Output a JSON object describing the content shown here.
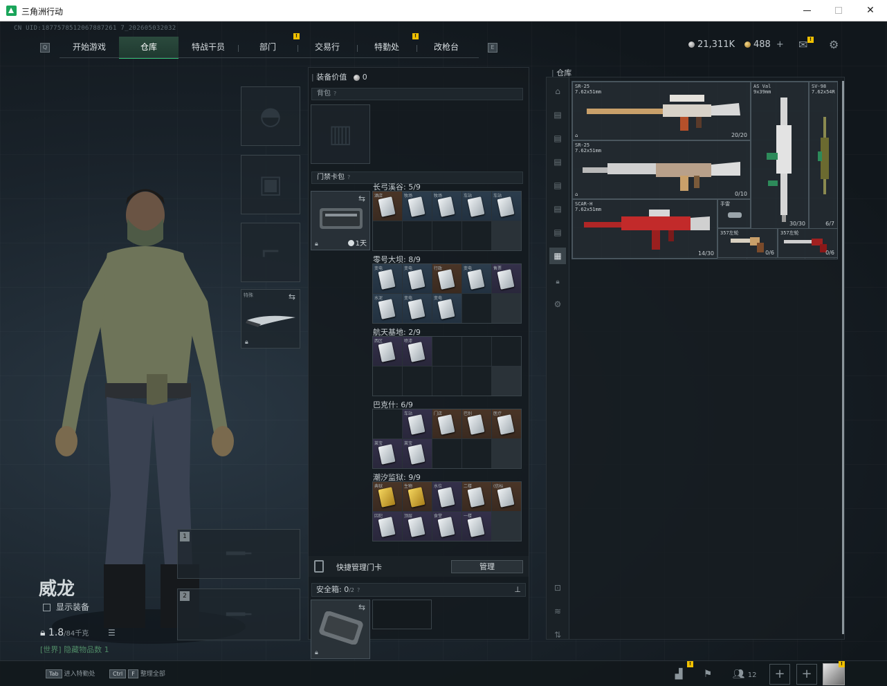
{
  "window": {
    "title": "三角洲行动"
  },
  "uid": "CN UID:1877578512067887261 7_202605032032",
  "nav": {
    "left_key": "Q",
    "right_key": "E",
    "tabs": [
      {
        "label": "开始游戏",
        "active": false,
        "alert": false
      },
      {
        "label": "仓库",
        "active": true,
        "alert": false
      },
      {
        "label": "特战干员",
        "active": false,
        "alert": false
      },
      {
        "label": "部门",
        "active": false,
        "alert": true
      },
      {
        "label": "交易行",
        "active": false,
        "alert": false
      },
      {
        "label": "特勤处",
        "active": false,
        "alert": true
      },
      {
        "label": "改枪台",
        "active": false,
        "alert": false
      }
    ]
  },
  "currency": {
    "silver": "21,311K",
    "gold": "488",
    "add": "+"
  },
  "alert_mark": "!",
  "operator": {
    "name": "威龙",
    "show_gear_label": "显示装备",
    "weight": "1.8",
    "weight_max": "/84千克",
    "world_tag": "[世界] 隐藏物品数 1"
  },
  "equip_slots": {
    "melee_label": "特殊",
    "primary_num": "1",
    "secondary_num": "2"
  },
  "loadout": {
    "value_label": "装备价值",
    "value": "0",
    "backpack_label": "背包",
    "keycard_bag_label": "门禁卡包",
    "keycard_time": "1天",
    "maps": [
      {
        "title": "长弓溪谷: 5/9",
        "cards": [
          {
            "name": "酒店",
            "tier": "brown"
          },
          {
            "name": "牧场",
            "tier": "blue"
          },
          {
            "name": "牧场",
            "tier": "blue"
          },
          {
            "name": "车站",
            "tier": "blue"
          },
          {
            "name": "车站",
            "tier": "blue"
          }
        ]
      },
      {
        "title": "零号大坝: 8/9",
        "cards": [
          {
            "name": "变电",
            "tier": "blue"
          },
          {
            "name": "变电",
            "tier": "blue"
          },
          {
            "name": "行政",
            "tier": "brown"
          },
          {
            "name": "变电",
            "tier": "blue"
          },
          {
            "name": "售票",
            "tier": "purple"
          },
          {
            "name": "水泥",
            "tier": "blue"
          },
          {
            "name": "变电",
            "tier": "blue"
          },
          {
            "name": "变电",
            "tier": "blue"
          }
        ]
      },
      {
        "title": "航天基地: 2/9",
        "cards": [
          {
            "name": "西区",
            "tier": "purple"
          },
          {
            "name": "喷漆",
            "tier": "purple"
          }
        ]
      },
      {
        "title": "巴克什: 6/9",
        "cards": [
          {
            "name": "",
            "tier": "empty"
          },
          {
            "name": "车站",
            "tier": "purple"
          },
          {
            "name": "门店",
            "tier": "brown"
          },
          {
            "name": "巴别",
            "tier": "brown"
          },
          {
            "name": "医疗",
            "tier": "brown"
          },
          {
            "name": "莱宝",
            "tier": "purple"
          },
          {
            "name": "莱宝",
            "tier": "purple"
          }
        ]
      },
      {
        "title": "潮汐监狱: 9/9",
        "cards": [
          {
            "name": "典狱",
            "tier": "gold"
          },
          {
            "name": "生物",
            "tier": "gold"
          },
          {
            "name": "水位",
            "tier": "purple"
          },
          {
            "name": "二楼",
            "tier": "brown"
          },
          {
            "name": "(信标",
            "tier": "brown"
          },
          {
            "name": "囚犯",
            "tier": "purple"
          },
          {
            "name": "顶层",
            "tier": "purple"
          },
          {
            "name": "食堂",
            "tier": "purple"
          },
          {
            "name": "一楼",
            "tier": "purple"
          }
        ]
      }
    ],
    "quick_manage_label": "快捷管理门卡",
    "manage_btn": "管理",
    "safe_label": "安全箱:",
    "safe_count": "0",
    "safe_cap": "/2"
  },
  "warehouse": {
    "title": "仓库",
    "weapons": [
      {
        "name": "SR-25",
        "caliber": "7.62x51mm",
        "ammo": "20/20"
      },
      {
        "name": "SR-25",
        "caliber": "7.62x51mm",
        "ammo": "0/10"
      },
      {
        "name": "SCAR-H",
        "caliber": "7.62x51mm",
        "ammo": "14/30"
      },
      {
        "name": "AS Val",
        "caliber": "9x39mm",
        "ammo": "30/30"
      },
      {
        "name": "SV-98",
        "caliber": "7.62x54R",
        "ammo": "6/7"
      },
      {
        "name": "手雷",
        "caliber": "",
        "ammo": ""
      },
      {
        "name": "357左轮",
        "caliber": "",
        "ammo": "0/6"
      },
      {
        "name": "357左轮",
        "caliber": "",
        "ammo": "0/6"
      }
    ]
  },
  "bottom": {
    "hint1_key": "Tab",
    "hint1_label": "进入特勤处",
    "hint2_key1": "Ctrl",
    "hint2_key2": "F",
    "hint2_label": "整理全部",
    "friends_count": "12"
  },
  "colors": {
    "accent": "#2fbf71",
    "alert": "#f0c000",
    "tier_gold": "#f5d65e",
    "tier_purple": "#34304a",
    "tier_blue": "#2c3d4d",
    "tier_brown": "#4a3527"
  }
}
